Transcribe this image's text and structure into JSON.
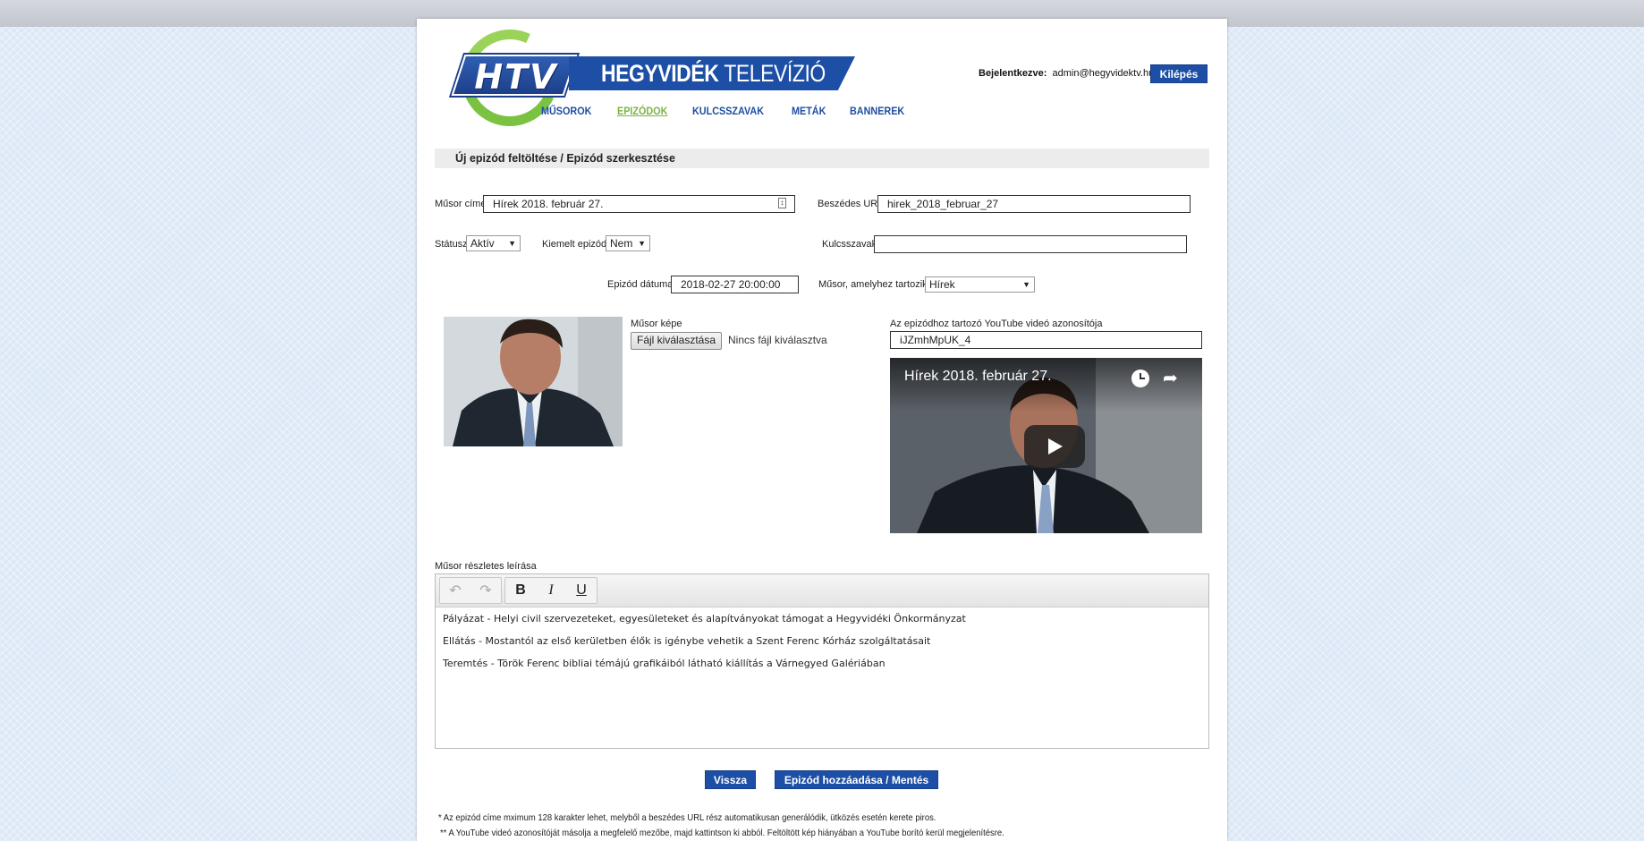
{
  "header": {
    "logo_text": "HTV",
    "brand_bold": "HEGYVIDÉK",
    "brand_thin": "TELEVÍZIÓ",
    "nav": [
      {
        "label": "MŰSOROK",
        "active": false
      },
      {
        "label": "EPIZÓDOK",
        "active": true
      },
      {
        "label": "KULCSSZAVAK",
        "active": false
      },
      {
        "label": "METÁK",
        "active": false
      },
      {
        "label": "BANNEREK",
        "active": false
      }
    ],
    "login_label": "Bejelentkezve:",
    "login_user": "admin@hegyvidektv.hu",
    "logout_label": "Kilépés"
  },
  "section_title": "Új epizód feltöltése / Epizód szerkesztése",
  "form": {
    "title_label": "Műsor címe",
    "title_value": "Hírek 2018. február 27.",
    "url_label": "Beszédes URL",
    "url_value": "hirek_2018_februar_27",
    "status_label": "Státusz",
    "status_value": "Aktív",
    "featured_label": "Kiemelt epizód",
    "featured_value": "Nem",
    "keywords_label": "Kulcsszavak",
    "keywords_value": "",
    "date_label": "Epizód dátuma",
    "date_value": "2018-02-27 20:00:00",
    "show_label": "Műsor, amelyhez tartozik",
    "show_value": "Hírek",
    "image_label": "Műsor képe",
    "file_button": "Fájl kiválasztása",
    "file_status": "Nincs fájl kiválasztva",
    "youtube_label": "Az epizódhoz tartozó YouTube videó azonosítója",
    "youtube_value": "iJZmhMpUK_4",
    "video_title": "Hírek 2018. február 27.",
    "description_label": "Műsor részletes leírása",
    "description": [
      "Pályázat - Helyi civil szervezeteket, egyesületeket és alapítványokat támogat a Hegyvidéki Önkormányzat",
      "Ellátás - Mostantól az első kerületben élők is igénybe vehetik a Szent Ferenc Kórház szolgáltatásait",
      "Teremtés - Török Ferenc bibliai témájú grafikáiból látható kiállítás a Várnegyed Galériában"
    ]
  },
  "actions": {
    "back_label": "Vissza",
    "save_label": "Epizód hozzáadása / Mentés"
  },
  "notes": [
    " * Az epizód címe mximum 128 karakter lehet, melyből a beszédes URL rész automatikusan generálódik, ütközés esetén kerete piros.",
    "** A YouTube videó azonosítóját másolja a megfelelő mezőbe, majd kattintson ki abból. Feltöltött kép hiányában a YouTube borító kerül megjelenítésre."
  ],
  "colors": {
    "brand_blue": "#1d4fa6",
    "brand_green": "#7cc242",
    "active_nav": "#7cb342"
  }
}
